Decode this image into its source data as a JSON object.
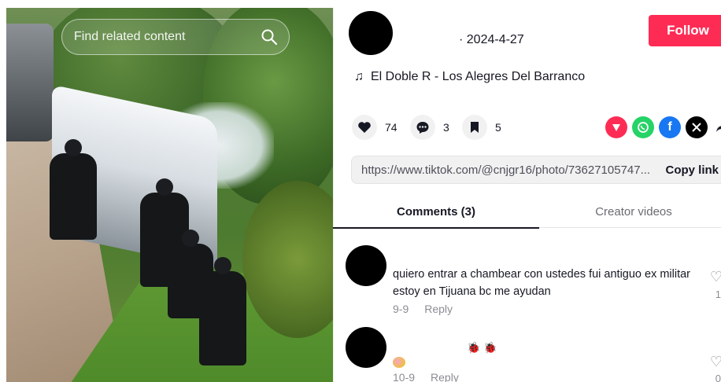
{
  "left_panel": {
    "search_placeholder": "Find related content",
    "icon": "search-icon"
  },
  "post": {
    "date": "· 2024-4-27",
    "follow_label": "Follow",
    "music": "El Doble R - Los Alegres Del Barranco",
    "likes": "74",
    "comments": "3",
    "saves": "5",
    "link": "https://www.tiktok.com/@cnjgr16/photo/73627105747...",
    "copy_label": "Copy link"
  },
  "share": {
    "colors": {
      "pink": "#fe2c55",
      "whatsapp": "#25d366",
      "facebook": "#1877f2",
      "x": "#000000"
    }
  },
  "tabs": {
    "comments": "Comments (3)",
    "creator": "Creator videos"
  },
  "comments": [
    {
      "text": "quiero entrar a chambear con ustedes fui antiguo ex militar estoy en Tijuana bc me ayudan",
      "date": "9-9",
      "reply": "Reply",
      "like_count": "1"
    },
    {
      "date": "10-9",
      "reply": "Reply",
      "like_count": "0"
    }
  ],
  "accent": "#fe2c55"
}
